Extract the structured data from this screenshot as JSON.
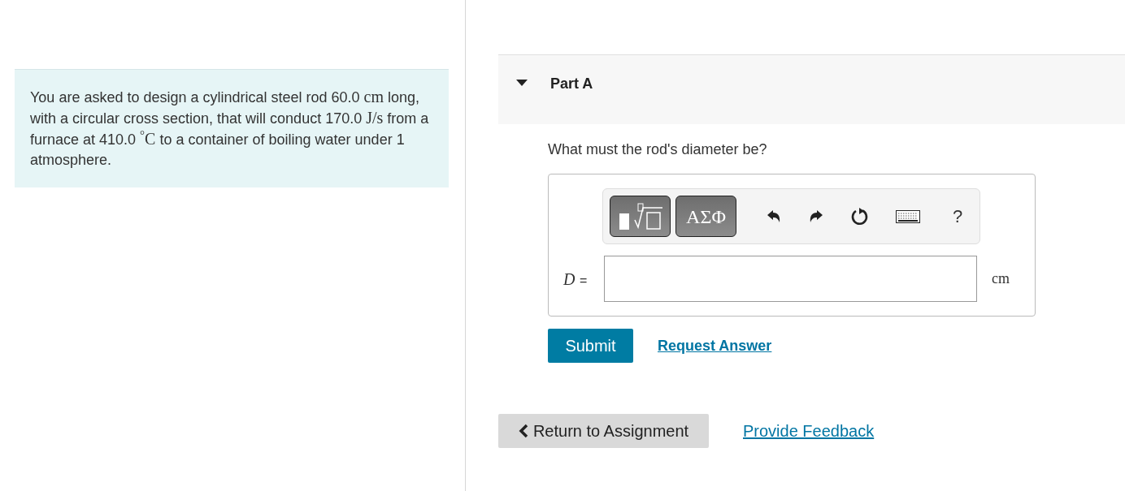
{
  "problem": {
    "segments": [
      {
        "kind": "text",
        "text": "You are asked to design a cylindrical steel rod 60.0 "
      },
      {
        "kind": "math",
        "text": "cm"
      },
      {
        "kind": "text",
        "text": " long, with a circular cross section, that will conduct 170.0 "
      },
      {
        "kind": "math",
        "text": "J/s"
      },
      {
        "kind": "text",
        "text": " from a furnace at 410.0 "
      },
      {
        "kind": "math",
        "text": "$^{°}$C"
      },
      {
        "kind": "text",
        "text": " to a container of boiling water under 1 atmosphere."
      }
    ]
  },
  "part": {
    "title": "Part A",
    "expanded": true
  },
  "question": "What must the rod's diameter be?",
  "toolbar": {
    "items": [
      {
        "kind": "templates"
      },
      {
        "kind": "symbols",
        "label": "ΑΣΦ"
      },
      {
        "kind": "undo"
      },
      {
        "kind": "redo"
      },
      {
        "kind": "reset"
      },
      {
        "kind": "keyboard"
      },
      {
        "kind": "help",
        "label": "?"
      }
    ]
  },
  "answer": {
    "variable": "D",
    "equals": "=",
    "unit": "cm"
  },
  "submit": "Submit",
  "request_answer": "Request Answer",
  "return_button": "Return to Assignment",
  "feedback_link": "Provide Feedback"
}
